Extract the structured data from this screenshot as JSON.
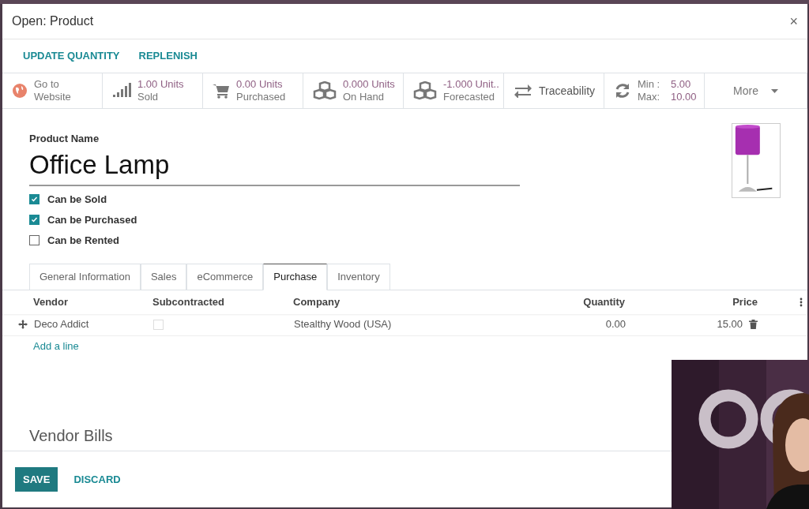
{
  "window": {
    "title": "Open: Product",
    "close": "×"
  },
  "actions": [
    "UPDATE QUANTITY",
    "REPLENISH"
  ],
  "stat_buttons": [
    {
      "kind": "website",
      "line1": "Go to",
      "line2": "Website"
    },
    {
      "kind": "sold",
      "value": "1.00 Units",
      "label": "Sold"
    },
    {
      "kind": "purchased",
      "value": "0.00 Units",
      "label": "Purchased"
    },
    {
      "kind": "onhand",
      "value": "0.000 Units",
      "label": "On Hand"
    },
    {
      "kind": "forecasted",
      "value": "-1.000 Unit..",
      "label": "Forecasted"
    },
    {
      "kind": "traceability",
      "label": "Traceability"
    },
    {
      "kind": "reordering",
      "min_label": "Min :",
      "min_value": "5.00",
      "max_label": "Max:",
      "max_value": "10.00"
    },
    {
      "kind": "more",
      "label": "More"
    }
  ],
  "form": {
    "name_label": "Product Name",
    "name": "Office Lamp",
    "checkboxes": [
      {
        "label": "Can be Sold",
        "checked": true
      },
      {
        "label": "Can be Purchased",
        "checked": true
      },
      {
        "label": "Can be Rented",
        "checked": false
      }
    ],
    "tabs": [
      {
        "label": "General Information",
        "selected": false
      },
      {
        "label": "Sales",
        "selected": false
      },
      {
        "label": "eCommerce",
        "selected": false
      },
      {
        "label": "Purchase",
        "selected": true
      },
      {
        "label": "Inventory",
        "selected": false
      }
    ],
    "table": {
      "columns": [
        "Vendor",
        "Subcontracted",
        "Company",
        "Quantity",
        "Price"
      ],
      "rows": [
        {
          "vendor": "Deco Addict",
          "subcontracted": false,
          "company": "Stealthy Wood (USA)",
          "quantity": "0.00",
          "price": "15.00"
        }
      ],
      "add_line": "Add a line"
    },
    "section_title": "Vendor Bills"
  },
  "footer": [
    "SAVE",
    "DISCARD"
  ],
  "webcam": {
    "kind": "picture"
  }
}
